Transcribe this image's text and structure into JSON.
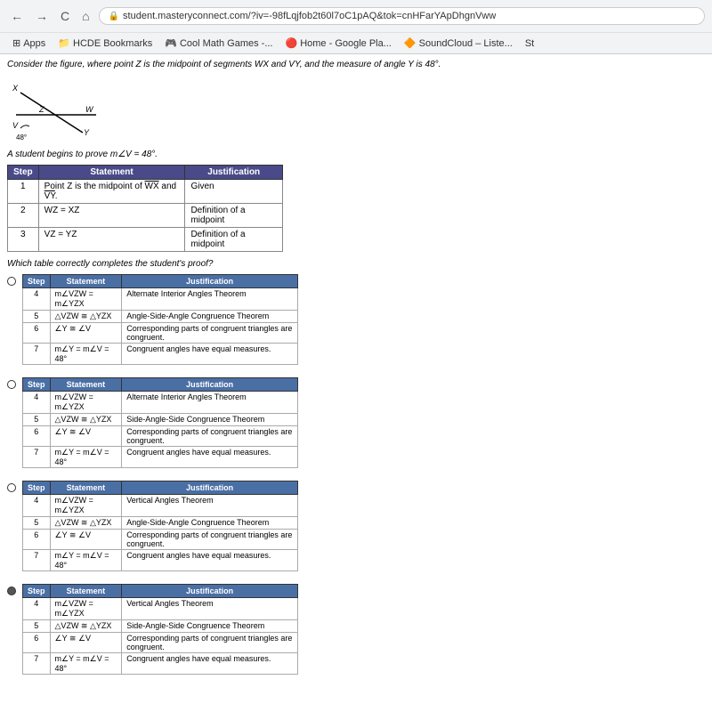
{
  "browser": {
    "back_label": "←",
    "forward_label": "→",
    "refresh_label": "C",
    "home_label": "⌂",
    "address": "student.masteryconnect.com/?iv=-98fLqjfob2t60l7oC1pAQ&tok=cnHFarYApDhgnVww",
    "bookmarks": [
      {
        "label": "Apps",
        "icon": "⊞"
      },
      {
        "label": "HCDE Bookmarks",
        "icon": "📁"
      },
      {
        "label": "Cool Math Games -...",
        "icon": "🎮"
      },
      {
        "label": "Home - Google Pla...",
        "icon": "🔴"
      },
      {
        "label": "SoundCloud – Liste...",
        "icon": "🔶"
      },
      {
        "label": "St",
        "icon": ""
      }
    ]
  },
  "page": {
    "problem_statement": "Consider the figure, where point Z is the midpoint of segments WX and VY, and the measure of angle Y is 48°.",
    "student_proves": "A student begins to prove m∠V = 48°.",
    "question_text": "Which table correctly completes the student's proof?",
    "proof_table": {
      "headers": [
        "Step",
        "Statement",
        "Justification"
      ],
      "rows": [
        {
          "step": "1",
          "statement": "Point Z is the midpoint of WX and VY.",
          "justification": "Given"
        },
        {
          "step": "2",
          "statement": "WZ = XZ",
          "justification": "Definition of a midpoint"
        },
        {
          "step": "3",
          "statement": "VZ = YZ",
          "justification": "Definition of a midpoint"
        }
      ]
    },
    "answer_choices": [
      {
        "id": "A",
        "rows": [
          {
            "step": "4",
            "statement": "m∠VZW = m∠YZX",
            "justification": "Alternate Interior Angles Theorem"
          },
          {
            "step": "5",
            "statement": "△VZW ≅ △YZX",
            "justification": "Angle-Side-Angle Congruence Theorem"
          },
          {
            "step": "6",
            "statement": "∠Y ≅ ∠V",
            "justification": "Corresponding parts of congruent triangles are congruent."
          },
          {
            "step": "7",
            "statement": "m∠Y = m∠V = 48°",
            "justification": "Congruent angles have equal measures."
          }
        ]
      },
      {
        "id": "B",
        "rows": [
          {
            "step": "4",
            "statement": "m∠VZW = m∠YZX",
            "justification": "Alternate Interior Angles Theorem"
          },
          {
            "step": "5",
            "statement": "△VZW ≅ △YZX",
            "justification": "Side-Angle-Side Congruence Theorem"
          },
          {
            "step": "6",
            "statement": "∠Y ≅ ∠V",
            "justification": "Corresponding parts of congruent triangles are congruent."
          },
          {
            "step": "7",
            "statement": "m∠Y = m∠V = 48°",
            "justification": "Congruent angles have equal measures."
          }
        ]
      },
      {
        "id": "C",
        "rows": [
          {
            "step": "4",
            "statement": "m∠VZW = m∠YZX",
            "justification": "Vertical Angles Theorem"
          },
          {
            "step": "5",
            "statement": "△VZW ≅ △YZX",
            "justification": "Angle-Side-Angle Congruence Theorem"
          },
          {
            "step": "6",
            "statement": "∠Y ≅ ∠V",
            "justification": "Corresponding parts of congruent triangles are congruent."
          },
          {
            "step": "7",
            "statement": "m∠Y = m∠V = 48°",
            "justification": "Congruent angles have equal measures."
          }
        ]
      },
      {
        "id": "D",
        "rows": [
          {
            "step": "4",
            "statement": "m∠VZW = m∠YZX",
            "justification": "Vertical Angles Theorem"
          },
          {
            "step": "5",
            "statement": "△VZW ≅ △YZX",
            "justification": "Side-Angle-Side Congruence Theorem"
          },
          {
            "step": "6",
            "statement": "∠Y ≅ ∠V",
            "justification": "Corresponding parts of congruent triangles are congruent."
          },
          {
            "step": "7",
            "statement": "m∠Y = m∠V = 48°",
            "justification": "Congruent angles have equal measures."
          }
        ]
      }
    ],
    "selected_answer": "D"
  }
}
